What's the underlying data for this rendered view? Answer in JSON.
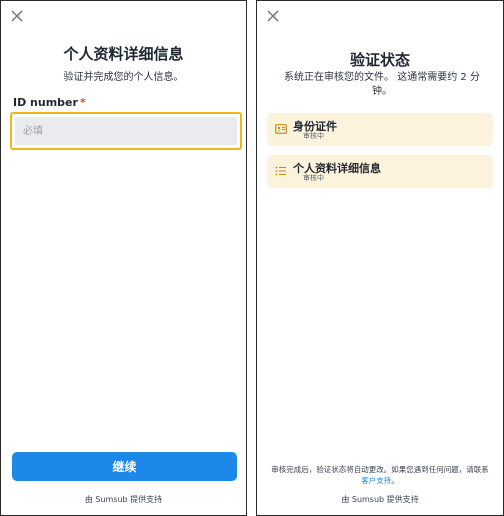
{
  "left": {
    "title": "个人资料详细信息",
    "subtitle": "验证并完成您的个人信息。",
    "field_label": "ID number",
    "required_mark": "*",
    "input_placeholder": "必填",
    "input_value": "",
    "continue_label": "继续",
    "footer": "由 Sumsub 提供支持"
  },
  "right": {
    "title": "验证状态",
    "subtitle": "系统正在审核您的文件。 这通常需要约 2 分钟。",
    "cards": [
      {
        "title": "身份证件",
        "status": "审核中",
        "icon": "id-card-icon"
      },
      {
        "title": "个人资料详细信息",
        "status": "审核中",
        "icon": "list-icon"
      }
    ],
    "note_prefix": "审核完成后，验证状态将自动更改。如果您遇到任何问题，请联系",
    "note_link": "客户支持",
    "note_suffix": "。",
    "footer": "由 Sumsub 提供支持"
  },
  "colors": {
    "accent": "#1e88e8",
    "focus_border": "#f2b51c",
    "card_bg": "#fdf3dc",
    "icon_gold": "#c98a12",
    "required": "#e0432f"
  }
}
